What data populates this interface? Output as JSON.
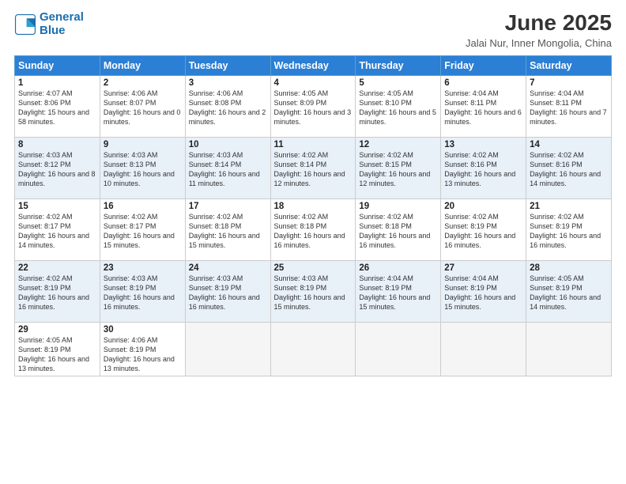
{
  "header": {
    "logo_line1": "General",
    "logo_line2": "Blue",
    "title": "June 2025",
    "subtitle": "Jalai Nur, Inner Mongolia, China"
  },
  "weekdays": [
    "Sunday",
    "Monday",
    "Tuesday",
    "Wednesday",
    "Thursday",
    "Friday",
    "Saturday"
  ],
  "weeks": [
    [
      {
        "day": 1,
        "sunrise": "4:07 AM",
        "sunset": "8:06 PM",
        "daylight": "15 hours and 58 minutes."
      },
      {
        "day": 2,
        "sunrise": "4:06 AM",
        "sunset": "8:07 PM",
        "daylight": "16 hours and 0 minutes."
      },
      {
        "day": 3,
        "sunrise": "4:06 AM",
        "sunset": "8:08 PM",
        "daylight": "16 hours and 2 minutes."
      },
      {
        "day": 4,
        "sunrise": "4:05 AM",
        "sunset": "8:09 PM",
        "daylight": "16 hours and 3 minutes."
      },
      {
        "day": 5,
        "sunrise": "4:05 AM",
        "sunset": "8:10 PM",
        "daylight": "16 hours and 5 minutes."
      },
      {
        "day": 6,
        "sunrise": "4:04 AM",
        "sunset": "8:11 PM",
        "daylight": "16 hours and 6 minutes."
      },
      {
        "day": 7,
        "sunrise": "4:04 AM",
        "sunset": "8:11 PM",
        "daylight": "16 hours and 7 minutes."
      }
    ],
    [
      {
        "day": 8,
        "sunrise": "4:03 AM",
        "sunset": "8:12 PM",
        "daylight": "16 hours and 8 minutes."
      },
      {
        "day": 9,
        "sunrise": "4:03 AM",
        "sunset": "8:13 PM",
        "daylight": "16 hours and 10 minutes."
      },
      {
        "day": 10,
        "sunrise": "4:03 AM",
        "sunset": "8:14 PM",
        "daylight": "16 hours and 11 minutes."
      },
      {
        "day": 11,
        "sunrise": "4:02 AM",
        "sunset": "8:14 PM",
        "daylight": "16 hours and 12 minutes."
      },
      {
        "day": 12,
        "sunrise": "4:02 AM",
        "sunset": "8:15 PM",
        "daylight": "16 hours and 12 minutes."
      },
      {
        "day": 13,
        "sunrise": "4:02 AM",
        "sunset": "8:16 PM",
        "daylight": "16 hours and 13 minutes."
      },
      {
        "day": 14,
        "sunrise": "4:02 AM",
        "sunset": "8:16 PM",
        "daylight": "16 hours and 14 minutes."
      }
    ],
    [
      {
        "day": 15,
        "sunrise": "4:02 AM",
        "sunset": "8:17 PM",
        "daylight": "16 hours and 14 minutes."
      },
      {
        "day": 16,
        "sunrise": "4:02 AM",
        "sunset": "8:17 PM",
        "daylight": "16 hours and 15 minutes."
      },
      {
        "day": 17,
        "sunrise": "4:02 AM",
        "sunset": "8:18 PM",
        "daylight": "16 hours and 15 minutes."
      },
      {
        "day": 18,
        "sunrise": "4:02 AM",
        "sunset": "8:18 PM",
        "daylight": "16 hours and 16 minutes."
      },
      {
        "day": 19,
        "sunrise": "4:02 AM",
        "sunset": "8:18 PM",
        "daylight": "16 hours and 16 minutes."
      },
      {
        "day": 20,
        "sunrise": "4:02 AM",
        "sunset": "8:19 PM",
        "daylight": "16 hours and 16 minutes."
      },
      {
        "day": 21,
        "sunrise": "4:02 AM",
        "sunset": "8:19 PM",
        "daylight": "16 hours and 16 minutes."
      }
    ],
    [
      {
        "day": 22,
        "sunrise": "4:02 AM",
        "sunset": "8:19 PM",
        "daylight": "16 hours and 16 minutes."
      },
      {
        "day": 23,
        "sunrise": "4:03 AM",
        "sunset": "8:19 PM",
        "daylight": "16 hours and 16 minutes."
      },
      {
        "day": 24,
        "sunrise": "4:03 AM",
        "sunset": "8:19 PM",
        "daylight": "16 hours and 16 minutes."
      },
      {
        "day": 25,
        "sunrise": "4:03 AM",
        "sunset": "8:19 PM",
        "daylight": "16 hours and 15 minutes."
      },
      {
        "day": 26,
        "sunrise": "4:04 AM",
        "sunset": "8:19 PM",
        "daylight": "16 hours and 15 minutes."
      },
      {
        "day": 27,
        "sunrise": "4:04 AM",
        "sunset": "8:19 PM",
        "daylight": "16 hours and 15 minutes."
      },
      {
        "day": 28,
        "sunrise": "4:05 AM",
        "sunset": "8:19 PM",
        "daylight": "16 hours and 14 minutes."
      }
    ],
    [
      {
        "day": 29,
        "sunrise": "4:05 AM",
        "sunset": "8:19 PM",
        "daylight": "16 hours and 13 minutes."
      },
      {
        "day": 30,
        "sunrise": "4:06 AM",
        "sunset": "8:19 PM",
        "daylight": "16 hours and 13 minutes."
      },
      null,
      null,
      null,
      null,
      null
    ]
  ]
}
